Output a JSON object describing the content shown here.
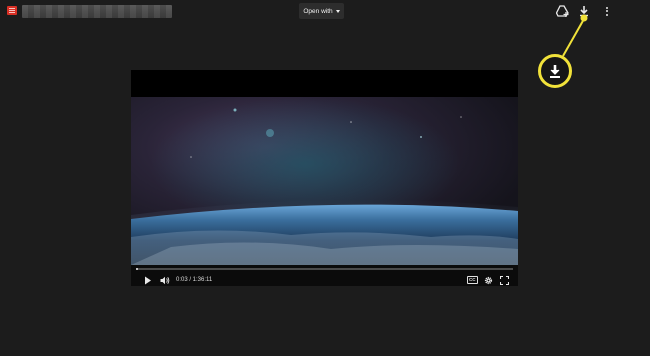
{
  "topbar": {
    "file_name": "",
    "open_with_label": "Open with"
  },
  "player": {
    "time": "0:03 / 1:36:11",
    "progress_fraction": 0.005,
    "cc_label": "CC"
  },
  "colors": {
    "background": "#1c1c1c",
    "callout_yellow": "#f1e23a",
    "file_icon_red": "#d93025"
  },
  "icons": {
    "file": "file-video-icon",
    "drive_add": "add-to-drive-icon",
    "download": "download-icon",
    "more": "more-vert-icon",
    "play": "play-icon",
    "volume": "volume-icon",
    "captions": "captions-icon",
    "settings": "gear-icon",
    "fullscreen": "fullscreen-icon"
  }
}
